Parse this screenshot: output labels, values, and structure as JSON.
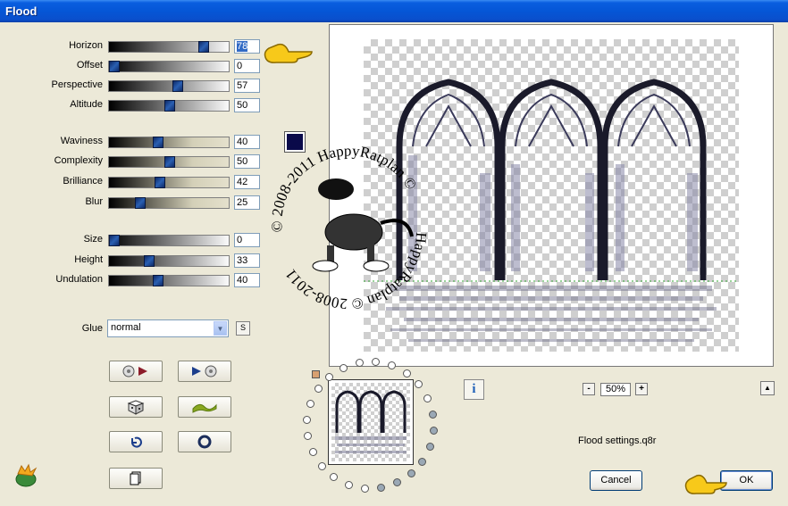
{
  "window": {
    "title": "Flood"
  },
  "params": [
    {
      "key": "horizon",
      "label": "Horizon",
      "value": "78",
      "level": 0.78,
      "selected": true
    },
    {
      "key": "offset",
      "label": "Offset",
      "value": "0",
      "level": 0.0
    },
    {
      "key": "perspective",
      "label": "Perspective",
      "value": "57",
      "level": 0.57
    },
    {
      "key": "altitude",
      "label": "Altitude",
      "value": "50",
      "level": 0.5
    },
    {
      "key": "waviness",
      "label": "Waviness",
      "value": "40",
      "level": 0.4
    },
    {
      "key": "complexity",
      "label": "Complexity",
      "value": "50",
      "level": 0.5
    },
    {
      "key": "brilliance",
      "label": "Brilliance",
      "value": "42",
      "level": 0.42
    },
    {
      "key": "blur",
      "label": "Blur",
      "value": "25",
      "level": 0.25
    },
    {
      "key": "size",
      "label": "Size",
      "value": "0",
      "level": 0.0
    },
    {
      "key": "height",
      "label": "Height",
      "value": "33",
      "level": 0.33
    },
    {
      "key": "undulation",
      "label": "Undulation",
      "value": "40",
      "level": 0.4
    }
  ],
  "color": {
    "swatch": "#0a0a4a"
  },
  "glue": {
    "label": "Glue",
    "value": "normal",
    "s_button": "S"
  },
  "zoom": {
    "minus": "-",
    "value": "50%",
    "plus": "+"
  },
  "info_label": "i",
  "settings_file": "Flood settings.q8r",
  "buttons": {
    "cancel": "Cancel",
    "ok": "OK"
  },
  "watermark": {
    "text_top": "© 2008-2011 HappyRatplan ©",
    "text_bottom": "HappyRatplan © 2008-2011"
  }
}
